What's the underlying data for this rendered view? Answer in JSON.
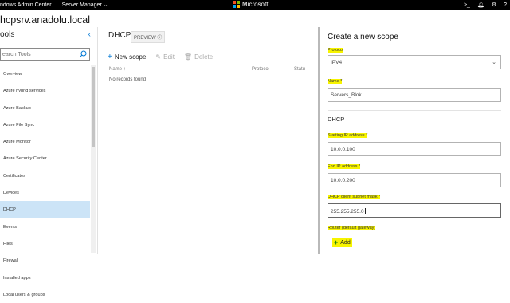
{
  "topbar": {
    "app_name": "ndows Admin Center",
    "server_manager": "Server Manager",
    "brand": "Microsoft",
    "icons": [
      "terminal-icon",
      "notifications-icon",
      "settings-icon",
      "help-icon"
    ]
  },
  "server": {
    "name": "hcpsrv.anadolu.local"
  },
  "tools": {
    "heading": "ools",
    "search_placeholder": "earch Tools",
    "items": [
      "Overview",
      "Azure hybrid services",
      "Azure Backup",
      "Azure File Sync",
      "Azure Monitor",
      "Azure Security Center",
      "Certificates",
      "Devices",
      "DHCP",
      "Events",
      "Files",
      "Firewall",
      "Installed apps",
      "Local users & groups"
    ],
    "active_item": "DHCP"
  },
  "main": {
    "title": "DHCP",
    "badge": "PREVIEW ⓘ",
    "toolbar": {
      "new_scope": "New scope",
      "edit": "Edit",
      "delete": "Delete"
    },
    "columns": [
      "Name ↑",
      "Protocol",
      "Statu"
    ],
    "empty_text": "No records found"
  },
  "panel": {
    "title": "Create a new scope",
    "protocol_label": "Protocol",
    "protocol_value": "IPV4",
    "name_label": "Name *",
    "name_value": "Servers_Blok",
    "dhcp_section": "DHCP",
    "start_ip_label": "Starting IP address *",
    "start_ip_value": "10.0.0.100",
    "end_ip_label": "End IP address *",
    "end_ip_value": "10.0.0.200",
    "mask_label": "DHCP client subnet mask *",
    "mask_value": "255.255.255.0",
    "router_label": "Router (default gateway)",
    "add_label": "Add"
  },
  "colors": {
    "accent": "#0078d4",
    "highlight": "#f7f400",
    "active_item_bg": "#cce4f7",
    "topbar_bg": "#000000"
  }
}
